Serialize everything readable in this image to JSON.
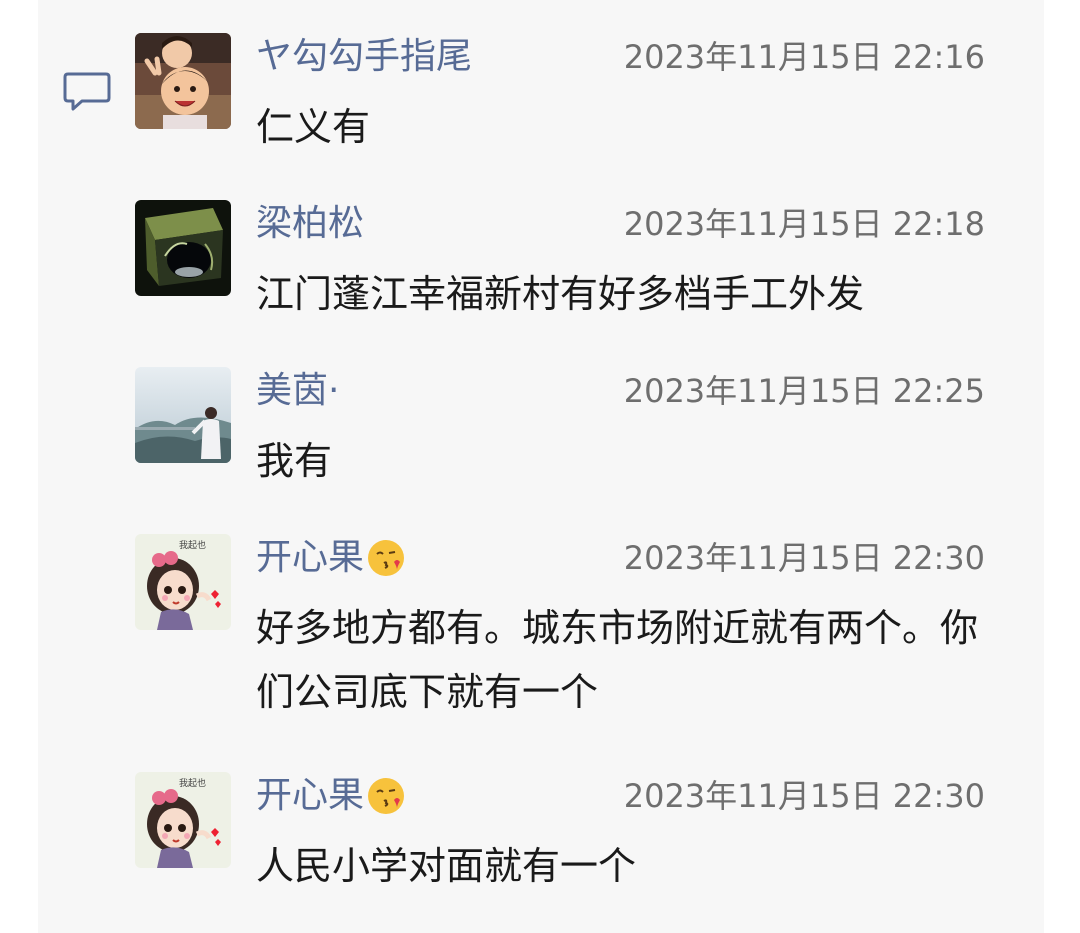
{
  "comments": [
    {
      "name": "ヤ勾勾手指尾",
      "time": "2023年11月15日 22:16",
      "text": "仁义有",
      "avatar": "avatar-children"
    },
    {
      "name": "梁柏松",
      "time": "2023年11月15日 22:18",
      "text": "江门蓬江幸福新村有好多档手工外发",
      "avatar": "avatar-glass-cube"
    },
    {
      "name": "美茵·",
      "time": "2023年11月15日 22:25",
      "text": "我有",
      "avatar": "avatar-landscape"
    },
    {
      "name": "开心果",
      "time": "2023年11月15日 22:30",
      "text": "好多地方都有。城东市场附近就有两个。你们公司底下就有一个",
      "avatar": "avatar-cartoon-girl",
      "name_emoji": "kissing-face-emoji"
    },
    {
      "name": "开心果",
      "time": "2023年11月15日 22:30",
      "text": "人民小学对面就有一个",
      "avatar": "avatar-cartoon-girl",
      "name_emoji": "kissing-face-emoji"
    }
  ],
  "avatar_stamp_text": "我起也",
  "colors": {
    "name": "#576b95",
    "time": "#6e6e6e",
    "text": "#1a1a1a",
    "panel": "#f7f7f7"
  }
}
